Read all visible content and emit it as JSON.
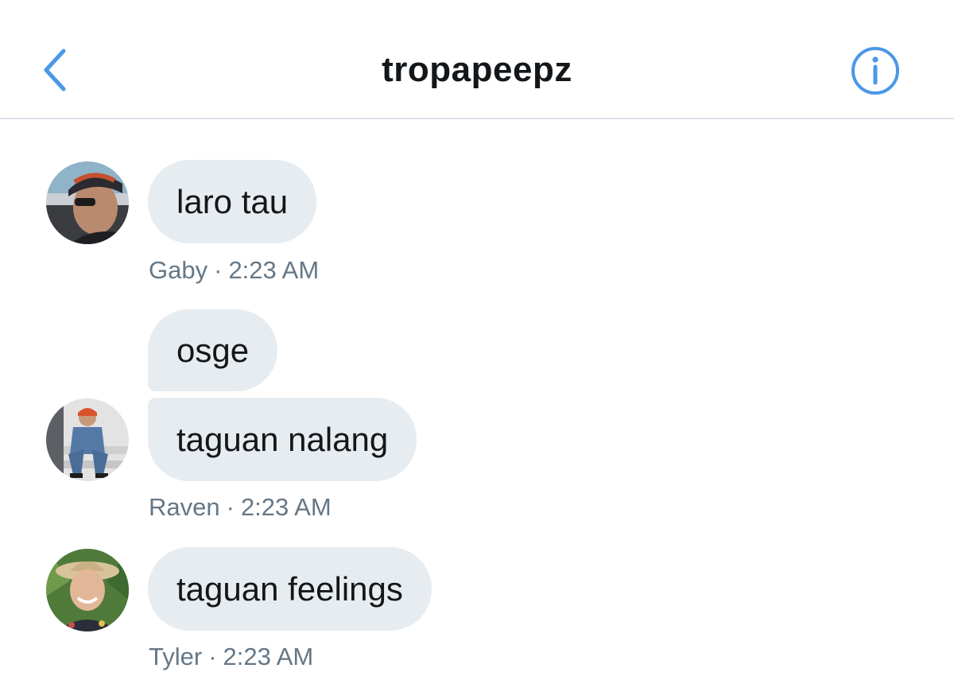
{
  "header": {
    "title": "tropapeepz",
    "back_icon": "chevron-left-icon",
    "info_icon": "info-circle-icon",
    "accent_color": "#4a98e8"
  },
  "messages": [
    {
      "sender": "Gaby",
      "text": "laro tau",
      "time": "2:23 AM"
    },
    {
      "sender": "Raven",
      "text": "osge",
      "time": ""
    },
    {
      "sender": "Raven",
      "text": "taguan nalang",
      "time": "2:23 AM"
    },
    {
      "sender": "Tyler",
      "text": "taguan feelings",
      "time": "2:23 AM"
    }
  ],
  "separator": "·",
  "colors": {
    "bubble": "#e6ecf0",
    "meta_text": "#657786",
    "divider": "#dfe3ea"
  }
}
